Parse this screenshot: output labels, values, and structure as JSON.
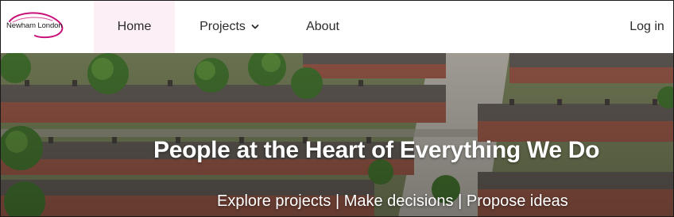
{
  "brand": {
    "name": "Newham London",
    "accent": "#c8127a"
  },
  "nav": {
    "items": [
      {
        "label": "Home",
        "active": true
      },
      {
        "label": "Projects",
        "has_dropdown": true,
        "icon": "chevron-down-icon"
      },
      {
        "label": "About"
      }
    ],
    "login_label": "Log in",
    "active_bg": "#fcf0f6"
  },
  "hero": {
    "title": "People at the Heart of Everything We Do",
    "subtitle": "Explore projects | Make decisions | Propose ideas"
  }
}
